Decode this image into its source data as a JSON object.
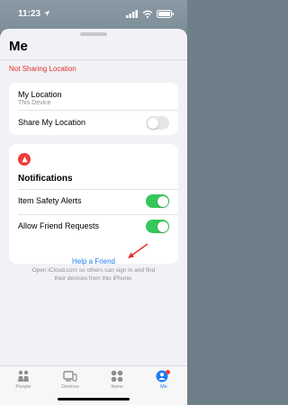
{
  "status_bar": {
    "time": "11:23"
  },
  "sheet": {
    "title": "Me",
    "not_sharing": "Not Sharing Location"
  },
  "location_card": {
    "my_location_label": "My Location",
    "my_location_sub": "This Device",
    "share_label": "Share My Location",
    "share_on": false
  },
  "notifications_card": {
    "heading": "Notifications",
    "item_safety_label": "Item Safety Alerts",
    "item_safety_on": true,
    "friend_requests_label": "Allow Friend Requests",
    "friend_requests_on": true
  },
  "help": {
    "link": "Help a Friend",
    "description": "Open iCloud.com so others can sign in and find their devices from this iPhone."
  },
  "tabs": [
    {
      "label": "People",
      "icon": "people-icon"
    },
    {
      "label": "Devices",
      "icon": "devices-icon"
    },
    {
      "label": "Items",
      "icon": "items-icon"
    },
    {
      "label": "Me",
      "icon": "me-icon",
      "active": true
    }
  ],
  "colors": {
    "accent": "#1e7cf2",
    "alert_red": "#e5302b",
    "toggle_on": "#34c759"
  }
}
